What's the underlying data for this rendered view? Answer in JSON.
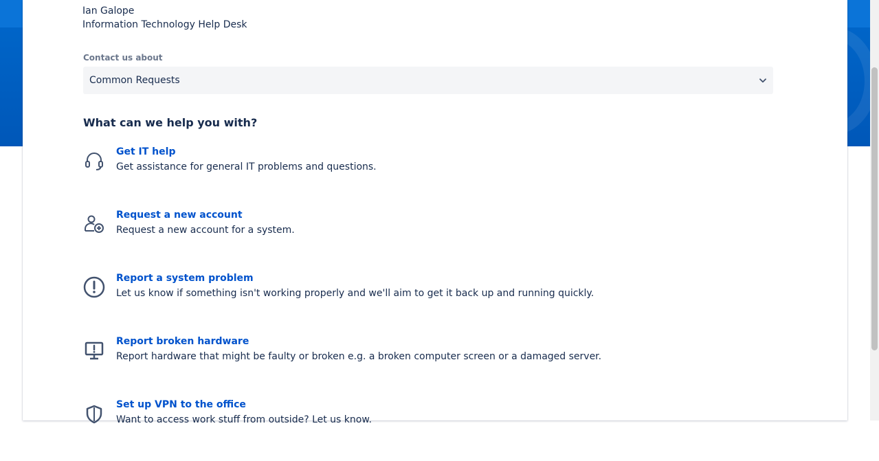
{
  "user": {
    "name": "Ian Galope",
    "team": "Information Technology Help Desk"
  },
  "contact": {
    "label": "Contact us about",
    "selected": "Common Requests"
  },
  "help": {
    "heading": "What can we help you with?",
    "items": [
      {
        "icon": "headset-icon",
        "title": "Get IT help",
        "description": "Get assistance for general IT problems and questions."
      },
      {
        "icon": "add-user-icon",
        "title": "Request a new account",
        "description": "Request a new account for a system."
      },
      {
        "icon": "exclamation-circle-icon",
        "title": "Report a system problem",
        "description": "Let us know if something isn't working properly and we'll aim to get it back up and running quickly."
      },
      {
        "icon": "monitor-alert-icon",
        "title": "Report broken hardware",
        "description": "Report hardware that might be faulty or broken e.g. a broken computer screen or a damaged server."
      },
      {
        "icon": "shield-icon",
        "title": "Set up VPN to the office",
        "description": "Want to access work stuff from outside? Let us know."
      }
    ]
  },
  "colors": {
    "banner": "#0065c8",
    "link": "#0052cc",
    "text": "#172b4d",
    "icon": "#42526e"
  }
}
